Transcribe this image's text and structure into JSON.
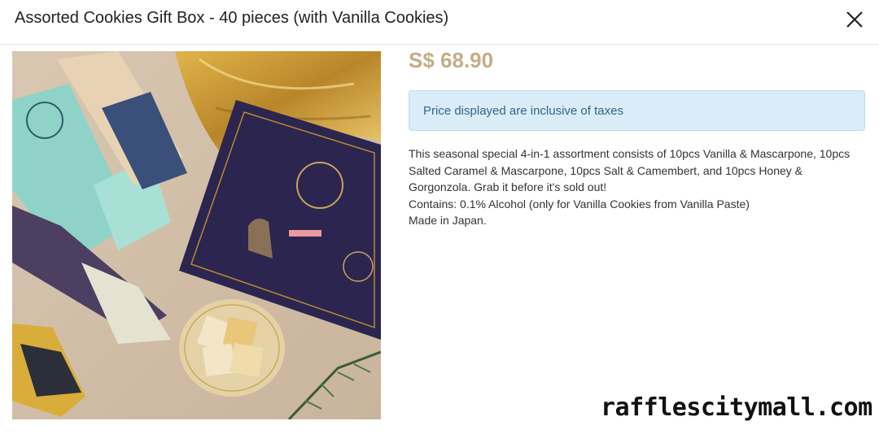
{
  "modal": {
    "title": "Assorted Cookies Gift Box - 40 pieces (with Vanilla Cookies)",
    "close_icon": "close-icon"
  },
  "product": {
    "price": "S$ 68.90",
    "tax_note": "Price displayed are inclusive of taxes",
    "description_lines": [
      "This seasonal special 4-in-1 assortment consists of 10pcs Vanilla & Mascarpone, 10pcs",
      "Salted Caramel & Mascarpone, 10pcs Salt & Camembert, and 10pcs Honey &",
      "Gorgonzola. Grab it before it's sold out!",
      "Contains: 0.1% Alcohol (only for Vanilla Cookies from Vanilla Paste)",
      "Made in Japan."
    ]
  },
  "watermark": "rafflescitymall.com",
  "colors": {
    "price": "#c4ad85",
    "tax_bg": "#d9ecf7",
    "tax_text": "#33658a",
    "box_navy": "#2b2550",
    "gold": "#b98a2e"
  }
}
